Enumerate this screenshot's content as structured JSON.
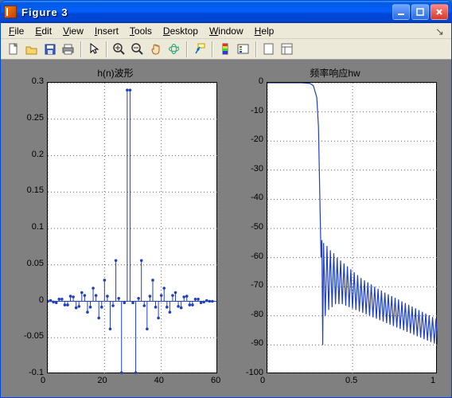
{
  "window": {
    "title": "Figure 3"
  },
  "menu": {
    "file": "File",
    "edit": "Edit",
    "view": "View",
    "insert": "Insert",
    "tools": "Tools",
    "desktop": "Desktop",
    "window": "Window",
    "help": "Help"
  },
  "toolbar_icons": [
    "new-file-icon",
    "open-icon",
    "save-icon",
    "print-icon",
    "pointer-icon",
    "zoom-in-icon",
    "zoom-out-icon",
    "pan-icon",
    "rotate3d-icon",
    "data-cursor-icon",
    "colorbar-icon",
    "legend-icon",
    "hide-tools-icon",
    "show-tools-icon"
  ],
  "chart_data": [
    {
      "type": "stem",
      "title": "h(n)波形",
      "xlabel": "",
      "ylabel": "",
      "xlim": [
        0,
        60
      ],
      "ylim": [
        -0.1,
        0.3
      ],
      "xticks": [
        0,
        20,
        40,
        60
      ],
      "yticks": [
        -0.1,
        -0.05,
        0,
        0.05,
        0.1,
        0.15,
        0.2,
        0.25,
        0.3
      ],
      "x": [
        0,
        1,
        2,
        3,
        4,
        5,
        6,
        7,
        8,
        9,
        10,
        11,
        12,
        13,
        14,
        15,
        16,
        17,
        18,
        19,
        20,
        21,
        22,
        23,
        24,
        25,
        26,
        27,
        28,
        29,
        30,
        31,
        32,
        33,
        34,
        35,
        36,
        37,
        38,
        39,
        40,
        41,
        42,
        43,
        44,
        45,
        46,
        47,
        48,
        49,
        50,
        51,
        52,
        53,
        54,
        55,
        56,
        57,
        58
      ],
      "y": [
        0.0,
        0.001,
        -0.001,
        -0.002,
        0.003,
        0.003,
        -0.005,
        -0.005,
        0.007,
        0.006,
        -0.009,
        -0.007,
        0.012,
        0.008,
        -0.015,
        -0.008,
        0.018,
        0.008,
        -0.023,
        -0.008,
        0.029,
        0.007,
        -0.038,
        -0.006,
        0.056,
        0.004,
        -0.098,
        -0.002,
        0.29,
        0.29,
        -0.002,
        -0.098,
        0.004,
        0.056,
        -0.006,
        -0.038,
        0.007,
        0.029,
        -0.008,
        -0.023,
        0.008,
        0.018,
        -0.008,
        -0.015,
        0.008,
        0.012,
        -0.007,
        -0.009,
        0.006,
        0.007,
        -0.005,
        -0.005,
        0.003,
        0.003,
        -0.002,
        -0.001,
        0.001,
        0.0,
        0.0
      ]
    },
    {
      "type": "line",
      "title": "频率响应hw",
      "xlabel": "",
      "ylabel": "",
      "xlim": [
        0,
        1
      ],
      "ylim": [
        -100,
        0
      ],
      "xticks": [
        0,
        0.5,
        1
      ],
      "yticks": [
        -100,
        -90,
        -80,
        -70,
        -60,
        -50,
        -40,
        -30,
        -20,
        -10,
        0
      ],
      "x": [
        0.0,
        0.05,
        0.1,
        0.15,
        0.2,
        0.25,
        0.27,
        0.29,
        0.3,
        0.305,
        0.31,
        0.315,
        0.32,
        0.325,
        0.33,
        0.34,
        0.35,
        0.36,
        0.37,
        0.38,
        0.39,
        0.4,
        0.41,
        0.42,
        0.43,
        0.44,
        0.45,
        0.46,
        0.47,
        0.48,
        0.49,
        0.5,
        0.51,
        0.52,
        0.53,
        0.54,
        0.55,
        0.56,
        0.57,
        0.58,
        0.59,
        0.6,
        0.61,
        0.62,
        0.63,
        0.64,
        0.65,
        0.66,
        0.67,
        0.68,
        0.69,
        0.7,
        0.71,
        0.72,
        0.73,
        0.74,
        0.75,
        0.76,
        0.77,
        0.78,
        0.79,
        0.8,
        0.81,
        0.82,
        0.83,
        0.84,
        0.85,
        0.86,
        0.87,
        0.88,
        0.89,
        0.9,
        0.91,
        0.92,
        0.93,
        0.94,
        0.95,
        0.96,
        0.97,
        0.98,
        0.99,
        1.0
      ],
      "y": [
        0.0,
        0.0,
        0.0,
        0.0,
        0.0,
        -0.2,
        -1.0,
        -5.0,
        -15.0,
        -30.0,
        -45.0,
        -60.0,
        -54.0,
        -90.0,
        -55.0,
        -80.0,
        -56.0,
        -78.0,
        -57.5,
        -77.0,
        -58.5,
        -76.0,
        -60.0,
        -76.0,
        -61.0,
        -76.0,
        -62.0,
        -76.5,
        -63.0,
        -77.0,
        -64.0,
        -77.5,
        -65.0,
        -78.0,
        -66.0,
        -78.5,
        -67.0,
        -79.0,
        -67.8,
        -79.5,
        -68.5,
        -80.0,
        -69.2,
        -80.5,
        -70.0,
        -81.0,
        -70.7,
        -81.5,
        -71.3,
        -82.0,
        -72.0,
        -82.5,
        -72.6,
        -83.0,
        -73.2,
        -83.5,
        -73.8,
        -84.0,
        -74.4,
        -84.5,
        -75.0,
        -85.0,
        -75.6,
        -85.5,
        -76.2,
        -86.0,
        -76.8,
        -86.5,
        -77.4,
        -87.0,
        -78.0,
        -87.5,
        -78.6,
        -88.0,
        -79.2,
        -88.5,
        -79.8,
        -89.0,
        -80.4,
        -89.5,
        -81.0,
        -90.0
      ]
    }
  ]
}
